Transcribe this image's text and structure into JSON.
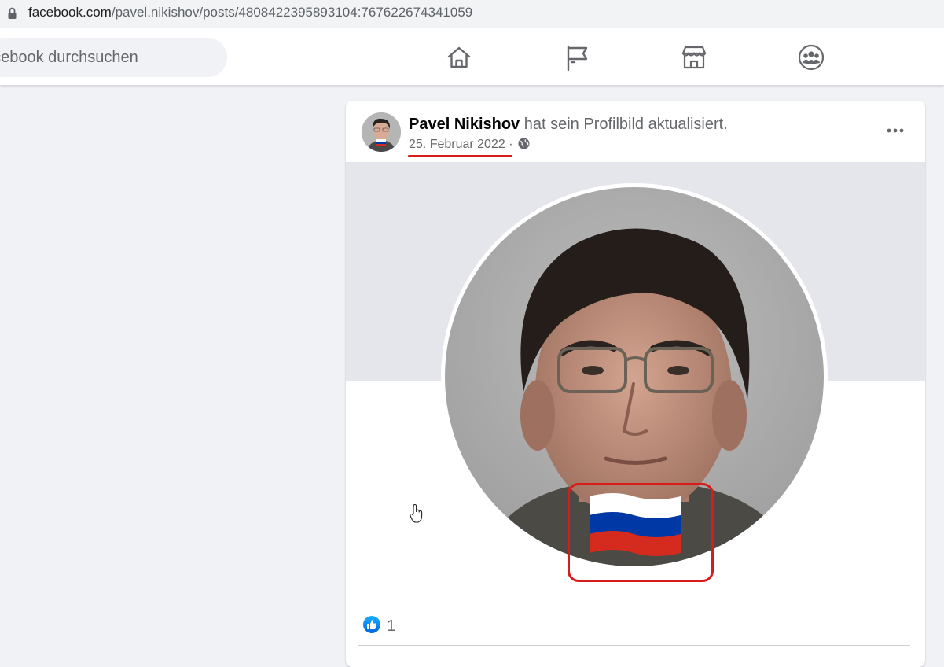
{
  "browser": {
    "url_host": "facebook.com",
    "url_path": "/pavel.nikishov/posts/4808422395893104:767622674341059",
    "lock_icon": "lock-icon"
  },
  "topnav": {
    "search_text": "acebook durchsuchen",
    "icons": [
      "home-icon",
      "pages-flag-icon",
      "marketplace-icon",
      "groups-icon"
    ]
  },
  "post": {
    "author": "Pavel Nikishov",
    "action": "hat sein Profilbild aktualisiert.",
    "date": "25. Februar 2022",
    "separator": " · ",
    "privacy_icon": "globe-icon",
    "more_icon": "more-options-icon",
    "likes": "1"
  },
  "colors": {
    "facebook_blue": "#1877f2",
    "highlight_red": "#d81b1b",
    "flag_white": "#ffffff",
    "flag_blue": "#0039a6",
    "flag_red": "#d52b1e"
  }
}
